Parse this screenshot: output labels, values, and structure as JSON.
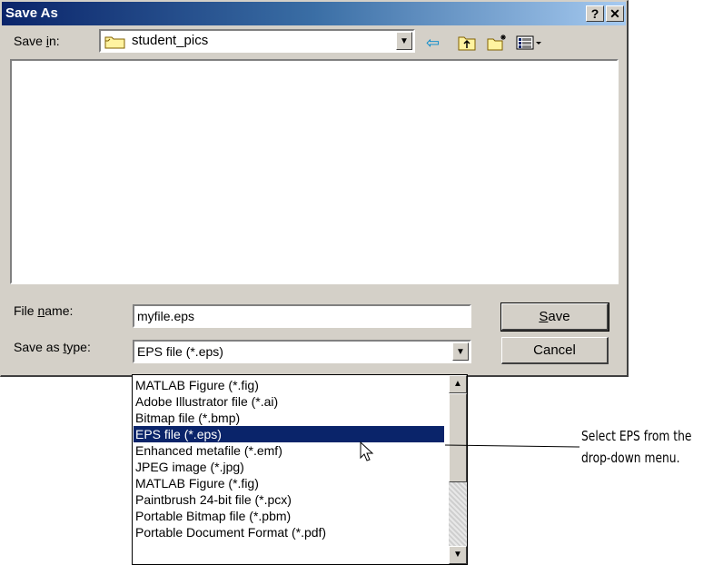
{
  "dialog": {
    "title": "Save As",
    "help_label": "?",
    "close_label": "✕",
    "save_in_prefix": "Save ",
    "save_in_key": "i",
    "save_in_suffix": "n:",
    "save_in_value": "student_pics",
    "toolbar_icons": [
      "back-arrow-icon",
      "up-folder-icon",
      "new-folder-icon",
      "view-menu-icon"
    ],
    "file_name_prefix": "File ",
    "file_name_key": "n",
    "file_name_suffix": "ame:",
    "file_name_value": "myfile.eps",
    "save_type_prefix": "Save as ",
    "save_type_key": "t",
    "save_type_suffix": "ype:",
    "save_type_value": "EPS file (*.eps)",
    "save_button_key": "S",
    "save_button_rest": "ave",
    "cancel_label": "Cancel"
  },
  "dropdown": {
    "items": [
      "MATLAB Figure (*.fig)",
      "Adobe Illustrator file (*.ai)",
      "Bitmap file (*.bmp)",
      "EPS file (*.eps)",
      "Enhanced metafile (*.emf)",
      "JPEG image (*.jpg)",
      "MATLAB Figure (*.fig)",
      "Paintbrush 24-bit file (*.pcx)",
      "Portable Bitmap file (*.pbm)",
      "Portable Document Format (*.pdf)"
    ],
    "selected_index": 3
  },
  "callout": {
    "line1": "Select EPS from the",
    "line2": "drop-down menu."
  },
  "colors": {
    "title_start": "#0a246a",
    "selection": "#0a246a",
    "face": "#d4d0c8"
  }
}
